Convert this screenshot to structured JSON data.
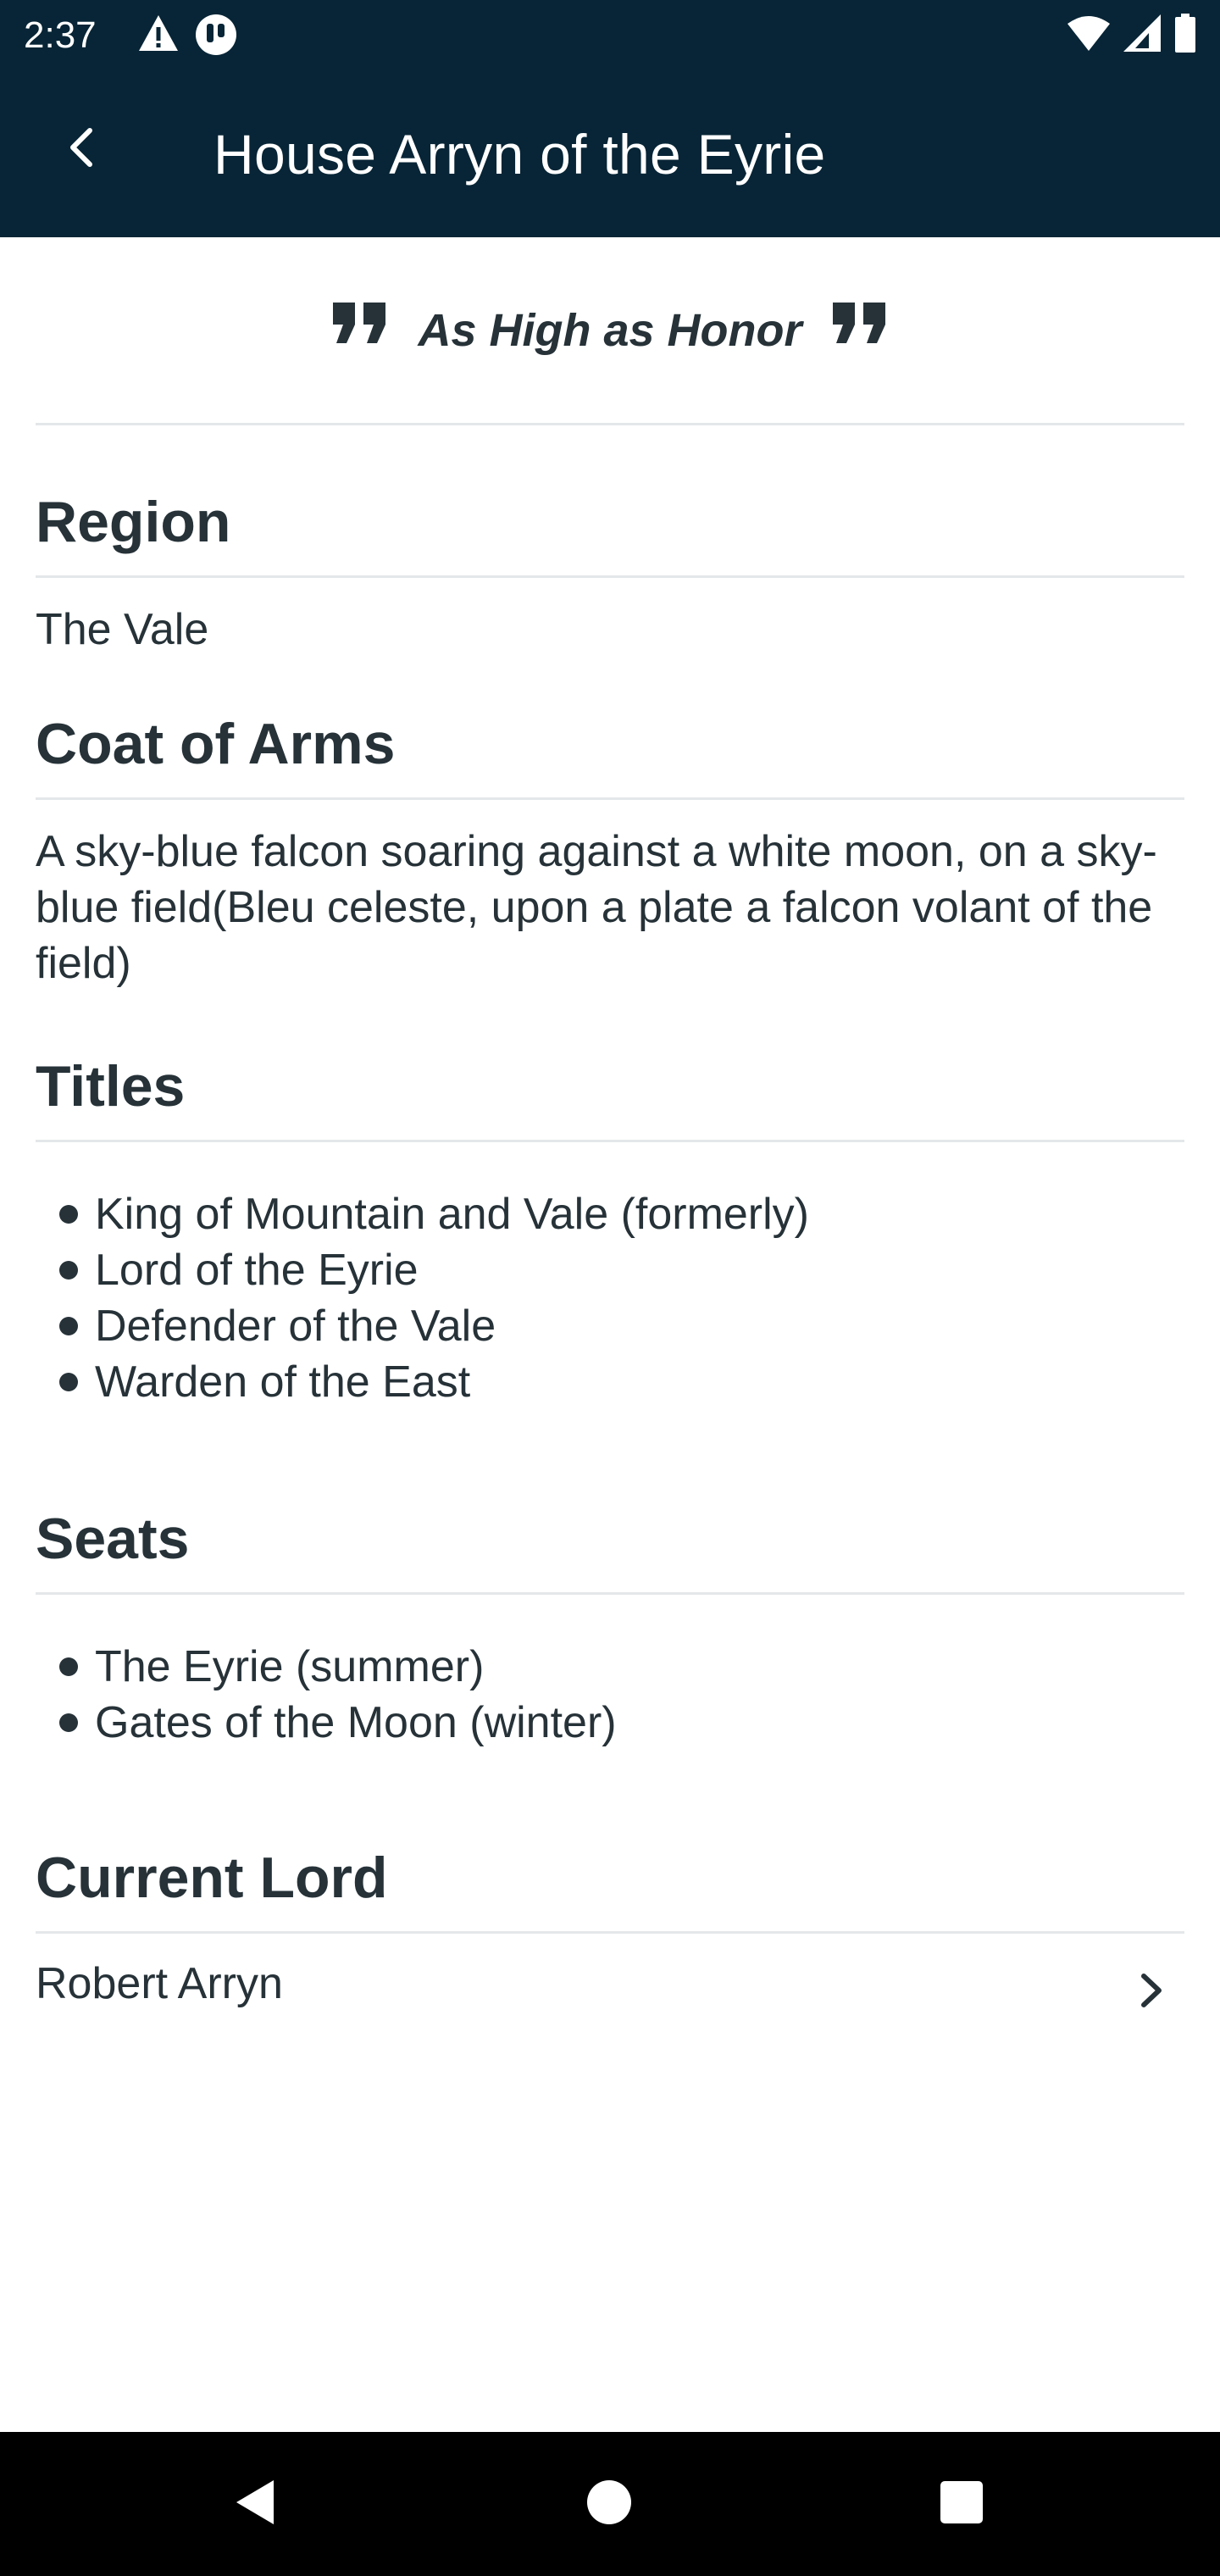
{
  "status_bar": {
    "time": "2:37",
    "left_icons": [
      "warning-icon",
      "notification-icon"
    ],
    "right_icons": [
      "wifi-icon",
      "signal-icon",
      "battery-icon"
    ]
  },
  "app_bar": {
    "title": "House Arryn of the Eyrie",
    "background": "#072536"
  },
  "motto": "As High as Honor",
  "sections": {
    "region": {
      "title": "Region",
      "value": "The Vale"
    },
    "coat_of_arms": {
      "title": "Coat of Arms",
      "value": "A sky-blue falcon soaring against a white moon, on a sky-blue field(Bleu celeste, upon a plate a falcon volant of the field)"
    },
    "titles": {
      "title": "Titles",
      "items": [
        "King of Mountain and Vale (formerly)",
        "Lord of the Eyrie",
        "Defender of the Vale",
        "Warden of the East"
      ]
    },
    "seats": {
      "title": "Seats",
      "items": [
        "The Eyrie (summer)",
        "Gates of the Moon (winter)"
      ]
    },
    "current_lord": {
      "title": "Current Lord",
      "value": "Robert Arryn"
    }
  },
  "nav_bar": [
    "back-icon",
    "home-icon",
    "recents-icon"
  ]
}
